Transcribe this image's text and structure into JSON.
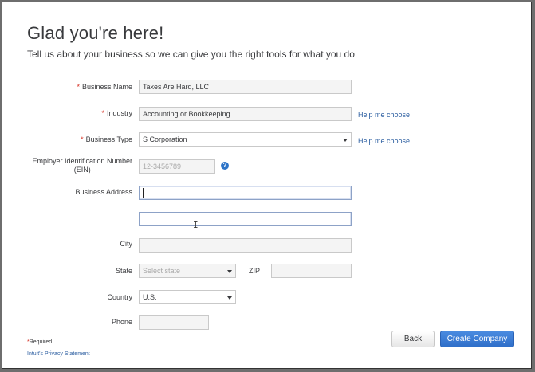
{
  "header": {
    "title": "Glad you're here!",
    "subtitle": "Tell us about your business so we can give you the right tools for what you do"
  },
  "form": {
    "business_name": {
      "label": "Business Name",
      "value": "Taxes Are Hard, LLC",
      "required": "*"
    },
    "industry": {
      "label": "Industry",
      "value": "Accounting or Bookkeeping",
      "required": "*",
      "help": "Help me choose"
    },
    "business_type": {
      "label": "Business Type",
      "value": "S Corporation",
      "required": "*",
      "help": "Help me choose"
    },
    "ein": {
      "label_line1": "Employer Identification Number",
      "label_line2": "(EIN)",
      "placeholder": "12-3456789",
      "help_glyph": "?"
    },
    "business_address": {
      "label": "Business Address",
      "line1": "",
      "line2": ""
    },
    "city": {
      "label": "City",
      "value": ""
    },
    "state": {
      "label": "State",
      "placeholder": "Select state"
    },
    "zip": {
      "label": "ZIP",
      "value": ""
    },
    "country": {
      "label": "Country",
      "value": "U.S."
    },
    "phone": {
      "label": "Phone",
      "value": ""
    }
  },
  "footer": {
    "required_mark": "*",
    "required_note": "Required",
    "privacy_link": "Intuit's Privacy Statement",
    "back_label": "Back",
    "create_label": "Create Company"
  },
  "colors": {
    "required": "#d52b1e",
    "link": "#2d5fa1",
    "primary_button": "#2f6fc9"
  },
  "icons": {
    "ein_help": "question-circle-icon",
    "select_caret": "caret-down-icon",
    "mouse_cursor": "text-cursor-icon"
  }
}
